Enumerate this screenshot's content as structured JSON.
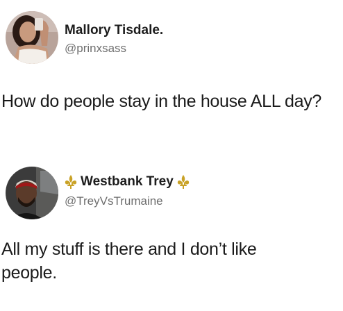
{
  "tweets": [
    {
      "display_name": "Mallory Tisdale.",
      "handle": "@prinxsass",
      "text": "How do people stay in the house ALL day?",
      "avatar_icon": "profile-photo-woman"
    },
    {
      "display_name": "Westbank Trey",
      "handle": "@TreyVsTrumaine",
      "text": "All my stuff is there and I don’t like people.",
      "avatar_icon": "profile-photo-man",
      "name_emoji": "fleur-de-lis"
    }
  ],
  "colors": {
    "name": "#1c1c1c",
    "handle": "#6f6f6f",
    "body": "#1a1a1a",
    "fleur": "#c9a227"
  }
}
